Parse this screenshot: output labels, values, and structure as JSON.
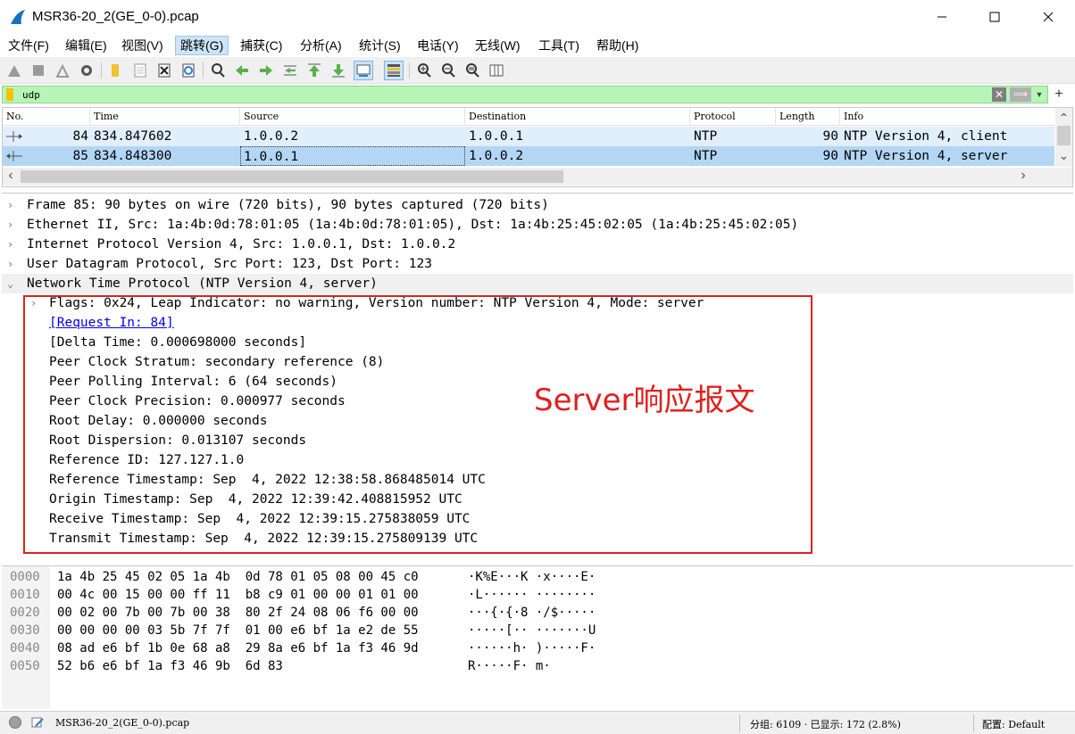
{
  "window": {
    "title": "MSR36-20_2(GE_0-0).pcap",
    "minimize": "—",
    "maximize": "☐",
    "close": "✕"
  },
  "menu": [
    "文件(F)",
    "编辑(E)",
    "视图(V)",
    "跳转(G)",
    "捕获(C)",
    "分析(A)",
    "统计(S)",
    "电话(Y)",
    "无线(W)",
    "工具(T)",
    "帮助(H)"
  ],
  "filter": {
    "value": "udp",
    "clear": "✕",
    "apply": "⟹",
    "dropdown": "▼",
    "add": "+"
  },
  "packet_list": {
    "columns": [
      "No.",
      "Time",
      "Source",
      "Destination",
      "Protocol",
      "Length",
      "Info"
    ],
    "rows": [
      {
        "no": "84",
        "time": "834.847602",
        "source": "1.0.0.2",
        "destination": "1.0.0.1",
        "protocol": "NTP",
        "length": "90",
        "info": "NTP Version 4, client"
      },
      {
        "no": "85",
        "time": "834.848300",
        "source": "1.0.0.1",
        "destination": "1.0.0.2",
        "protocol": "NTP",
        "length": "90",
        "info": "NTP Version 4, server"
      }
    ],
    "scroll_up": "⌃",
    "scroll_down": "⌄",
    "scroll_left": "‹",
    "scroll_right": "›"
  },
  "details": {
    "frame": "Frame 85: 90 bytes on wire (720 bits), 90 bytes captured (720 bits)",
    "ethernet": "Ethernet II, Src: 1a:4b:0d:78:01:05 (1a:4b:0d:78:01:05), Dst: 1a:4b:25:45:02:05 (1a:4b:25:45:02:05)",
    "ip": "Internet Protocol Version 4, Src: 1.0.0.1, Dst: 1.0.0.2",
    "udp": "User Datagram Protocol, Src Port: 123, Dst Port: 123",
    "ntp": "Network Time Protocol (NTP Version 4, server)",
    "ntp_fields": {
      "flags": "Flags: 0x24, Leap Indicator: no warning, Version number: NTP Version 4, Mode: server",
      "request_in": "[Request In: 84]",
      "delta_time": "[Delta Time: 0.000698000 seconds]",
      "stratum": "Peer Clock Stratum: secondary reference (8)",
      "polling": "Peer Polling Interval: 6 (64 seconds)",
      "precision": "Peer Clock Precision: 0.000977 seconds",
      "root_delay": "Root Delay: 0.000000 seconds",
      "root_dispersion": "Root Dispersion: 0.013107 seconds",
      "reference_id": "Reference ID: 127.127.1.0",
      "reference_ts": "Reference Timestamp: Sep  4, 2022 12:38:58.868485014 UTC",
      "origin_ts": "Origin Timestamp: Sep  4, 2022 12:39:42.408815952 UTC",
      "receive_ts": "Receive Timestamp: Sep  4, 2022 12:39:15.275838059 UTC",
      "transmit_ts": "Transmit Timestamp: Sep  4, 2022 12:39:15.275809139 UTC"
    },
    "annotation": "Server响应报文"
  },
  "bytes": [
    {
      "offset": "0000",
      "hex": "1a 4b 25 45 02 05 1a 4b  0d 78 01 05 08 00 45 c0",
      "ascii": "·K%E···K ·x····E·"
    },
    {
      "offset": "0010",
      "hex": "00 4c 00 15 00 00 ff 11  b8 c9 01 00 00 01 01 00",
      "ascii": "·L······ ········"
    },
    {
      "offset": "0020",
      "hex": "00 02 00 7b 00 7b 00 38  80 2f 24 08 06 f6 00 00",
      "ascii": "···{·{·8 ·/$·····"
    },
    {
      "offset": "0030",
      "hex": "00 00 00 00 03 5b 7f 7f  01 00 e6 bf 1a e2 de 55",
      "ascii": "·····[·· ·······U"
    },
    {
      "offset": "0040",
      "hex": "08 ad e6 bf 1b 0e 68 a8  29 8a e6 bf 1a f3 46 9d",
      "ascii": "······h· )·····F·"
    },
    {
      "offset": "0050",
      "hex": "52 b6 e6 bf 1a f3 46 9b  6d 83",
      "ascii": "R·····F· m·"
    }
  ],
  "status": {
    "file": "MSR36-20_2(GE_0-0).pcap",
    "stats": "分组: 6109 · 已显示: 172 (2.8%)",
    "profile": "配置: Default"
  },
  "colors": {
    "filter_bg": "#b6f5b6",
    "selected_row": "#b3d6f5",
    "highlight_box": "#e02020"
  }
}
